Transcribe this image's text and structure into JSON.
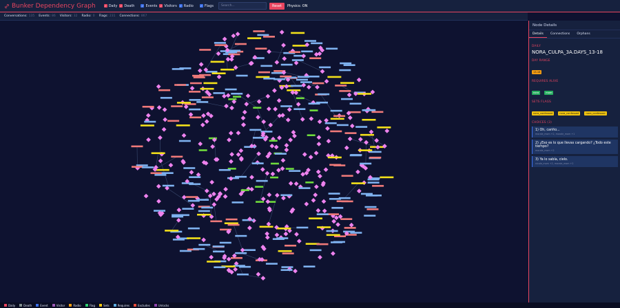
{
  "toolbar": {
    "title": "Bunker Dependency Graph",
    "filters": [
      {
        "label": "Daily"
      },
      {
        "label": "Death"
      },
      {
        "label": "Events"
      },
      {
        "label": "Visitors"
      },
      {
        "label": "Radio"
      },
      {
        "label": "Flags"
      }
    ],
    "search_placeholder": "Search...",
    "reset_label": "Reset",
    "physics_label": "Physics: ON"
  },
  "stats": [
    {
      "label": "Conversations:",
      "value": "135"
    },
    {
      "label": "Events:",
      "value": "86"
    },
    {
      "label": "Visitors:",
      "value": "32"
    },
    {
      "label": "Radio:",
      "value": "0"
    },
    {
      "label": "Flags:",
      "value": "231"
    },
    {
      "label": "Connections:",
      "value": "867"
    }
  ],
  "panel": {
    "title": "Node Details",
    "tabs": [
      "Details",
      "Connections",
      "Orphans"
    ],
    "type_label": "DAILY",
    "node_id": "NORA_CULPA_3A.DAYS_13-18",
    "day_range_label": "DAY RANGE",
    "day_range": "13-18",
    "requires_label": "REQUIRES ALIVE",
    "requires": [
      "nora",
      "mom"
    ],
    "sets_label": "SETS FLAGS",
    "sets": [
      "nora_confessed",
      "nora_confessed",
      "nora_confessed"
    ],
    "choices_label": "CHOICES (3)",
    "choices": [
      {
        "text": "1) Oh, cariño...",
        "stats": "morale_mom +2, morale_mom +1"
      },
      {
        "text": "2) ¿Eso es lo que llevas cargando? ¿Todo este tiempo?",
        "stats": "morale_mom +2"
      },
      {
        "text": "3) Ya lo sabía, cielo.",
        "stats": "nicole_mom +2, morale_mom +2"
      }
    ]
  },
  "legend": [
    {
      "label": "Daily",
      "color": "#e94560"
    },
    {
      "label": "Death",
      "color": "#7f8c8d"
    },
    {
      "label": "Event",
      "color": "#3a6ee8"
    },
    {
      "label": "Visitor",
      "color": "#9b59b6"
    },
    {
      "label": "Radio",
      "color": "#f39c12"
    },
    {
      "label": "Flag",
      "color": "#2ecc71"
    },
    {
      "label": "Sets",
      "color": "#f1c40f"
    },
    {
      "label": "Requires",
      "color": "#5dade2"
    },
    {
      "label": "Excludes",
      "color": "#e74c3c"
    },
    {
      "label": "Unlocks",
      "color": "#8e44ad"
    }
  ],
  "graph_colors": {
    "background": "#0e1230",
    "flag_node": "#ee82ee",
    "event_bar": "#7fb2f0",
    "daily_bar": "#f07a7a",
    "sets_bar": "#f4e11a",
    "hub_bar": "#6fdc3c",
    "edge": "#3a4a70"
  }
}
